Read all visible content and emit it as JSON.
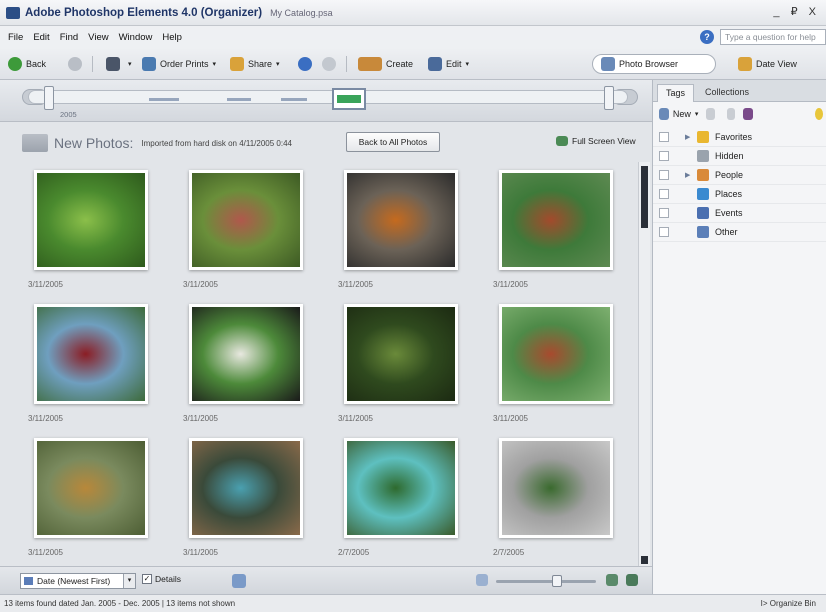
{
  "window": {
    "title": "Adobe Photoshop Elements 4.0 (Organizer)",
    "catalog": "My Catalog.psa",
    "controls": "_ ₽ X"
  },
  "menu": [
    "File",
    "Edit",
    "Find",
    "View",
    "Window",
    "Help"
  ],
  "help_search": {
    "placeholder": "Type a question for help"
  },
  "toolbar": {
    "back": "Back",
    "order_prints": "Order Prints",
    "share": "Share",
    "create": "Create",
    "edit": "Edit",
    "photo_browser": "Photo Browser",
    "date_view": "Date View"
  },
  "timeline": {
    "year": "2005"
  },
  "header": {
    "title": "New Photos:",
    "subtitle": "Imported from hard disk on 4/11/2005 0:44",
    "back_button": "Back to All Photos",
    "full_screen": "Full Screen View"
  },
  "photos": [
    {
      "date": "3/11/2005",
      "colors": [
        "#4a8a2e",
        "#8bbf4a",
        "#2e5a1c"
      ]
    },
    {
      "date": "3/11/2005",
      "colors": [
        "#6a8f3a",
        "#b0584c",
        "#3d5a24"
      ]
    },
    {
      "date": "3/11/2005",
      "colors": [
        "#6b6257",
        "#c56a1e",
        "#2b2b2b"
      ]
    },
    {
      "date": "3/11/2005",
      "colors": [
        "#3e7a3a",
        "#a34a2c",
        "#5e8a52"
      ]
    },
    {
      "date": "3/11/2005",
      "colors": [
        "#6f9fbf",
        "#8b1d24",
        "#3d6a3a"
      ]
    },
    {
      "date": "3/11/2005",
      "colors": [
        "#4d8a3a",
        "#e8e8e0",
        "#1a1a1a"
      ]
    },
    {
      "date": "3/11/2005",
      "colors": [
        "#2f4a1e",
        "#6a8a3a",
        "#1c2a12"
      ]
    },
    {
      "date": "3/11/2005",
      "colors": [
        "#4e8a48",
        "#a84a2e",
        "#7eb070"
      ]
    },
    {
      "date": "3/11/2005",
      "colors": [
        "#7a8a5e",
        "#b8883a",
        "#4d5e34"
      ]
    },
    {
      "date": "3/11/2005",
      "colors": [
        "#3a4a3a",
        "#4aa0b0",
        "#8a6a4a"
      ]
    },
    {
      "date": "2/7/2005",
      "colors": [
        "#5ec0c0",
        "#2e6a2e",
        "#3a5a2a"
      ]
    },
    {
      "date": "2/7/2005",
      "colors": [
        "#a0a0a0",
        "#3a6a2e",
        "#c8c8c8"
      ]
    }
  ],
  "bottom": {
    "sort": "Date (Newest First)",
    "details": "Details"
  },
  "status": {
    "left": "13 items found dated Jan. 2005 - Dec. 2005  |  13 items not shown",
    "right": "I> Organize Bin"
  },
  "tags_panel": {
    "tabs": [
      "Tags",
      "Collections"
    ],
    "new": "New",
    "items": [
      {
        "label": "Favorites",
        "icon": "star-icon",
        "color": "#e9b730",
        "expandable": true
      },
      {
        "label": "Hidden",
        "icon": "hidden-icon",
        "color": "#9aa3ad",
        "expandable": false
      },
      {
        "label": "People",
        "icon": "people-icon",
        "color": "#d98a3a",
        "expandable": true
      },
      {
        "label": "Places",
        "icon": "globe-icon",
        "color": "#3a8ad0",
        "expandable": false
      },
      {
        "label": "Events",
        "icon": "calendar-icon",
        "color": "#4a6fb0",
        "expandable": false
      },
      {
        "label": "Other",
        "icon": "other-icon",
        "color": "#5b7fb8",
        "expandable": false
      }
    ]
  }
}
